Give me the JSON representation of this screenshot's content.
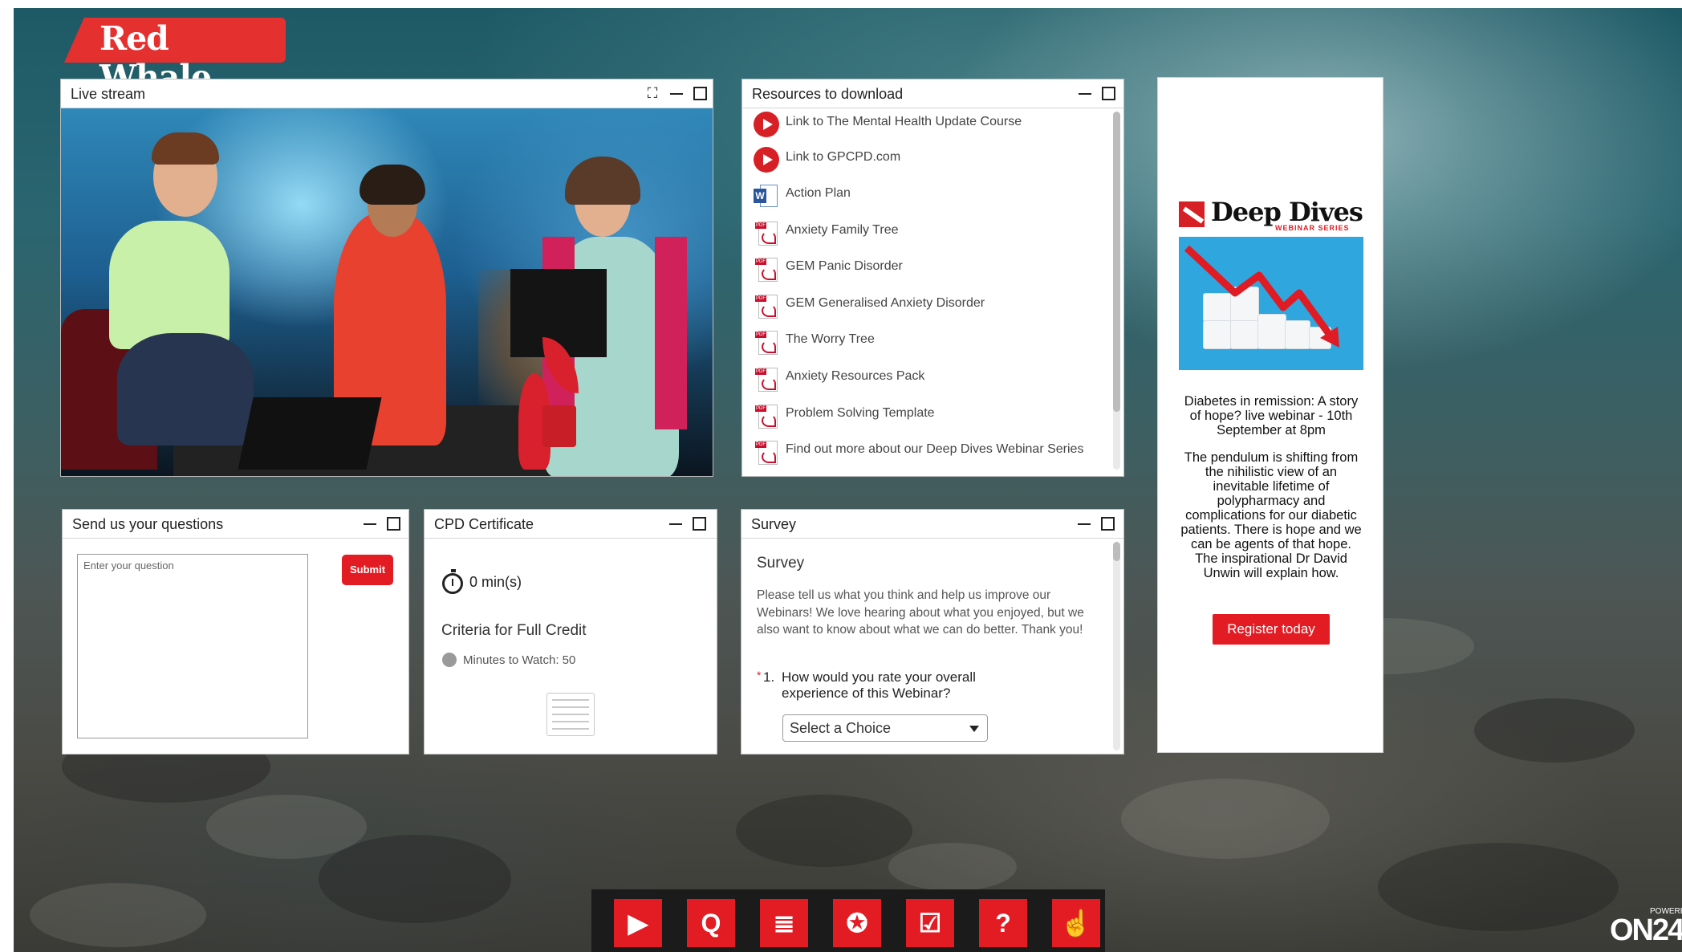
{
  "brand": {
    "name": "Red Whale",
    "powered_by": "POWERED BY",
    "on24": "ON24"
  },
  "live_stream": {
    "title": "Live stream"
  },
  "resources": {
    "title": "Resources to download",
    "items": [
      {
        "label": "Link to The Mental Health Update Course",
        "icon": "play-link-icon"
      },
      {
        "label": "Link to GPCPD.com",
        "icon": "play-link-icon"
      },
      {
        "label": "Action Plan",
        "icon": "word-doc-icon"
      },
      {
        "label": "Anxiety Family Tree",
        "icon": "pdf-icon"
      },
      {
        "label": "GEM Panic Disorder",
        "icon": "pdf-icon"
      },
      {
        "label": "GEM Generalised Anxiety Disorder",
        "icon": "pdf-icon"
      },
      {
        "label": "The Worry Tree",
        "icon": "pdf-icon"
      },
      {
        "label": "Anxiety Resources Pack",
        "icon": "pdf-icon"
      },
      {
        "label": "Problem Solving Template",
        "icon": "pdf-icon"
      },
      {
        "label": "Find out more about our Deep Dives Webinar Series",
        "icon": "pdf-icon"
      }
    ]
  },
  "ad": {
    "logo_text": "Deep Dives",
    "logo_sub": "WEBINAR SERIES",
    "headline": "Diabetes in remission: A story of hope? live webinar - 10th September at 8pm",
    "body": "The pendulum is shifting from the nihilistic view of an inevitable lifetime of polypharmacy and complications for our diabetic patients. There is hope and we can be agents of that hope. The inspirational Dr David Unwin will explain how.",
    "cta": "Register today"
  },
  "questions": {
    "title": "Send us your questions",
    "placeholder": "Enter your question",
    "submit": "Submit"
  },
  "cpd": {
    "title": "CPD Certificate",
    "time": "0 min(s)",
    "criteria_heading": "Criteria for Full Credit",
    "criteria_item": "Minutes to Watch: 50"
  },
  "survey": {
    "title": "Survey",
    "heading": "Survey",
    "intro": "Please tell us what you think and help us improve our Webinars!  We love hearing about what you enjoyed, but we also want to know about what we can do better. Thank you!",
    "required_mark": "*",
    "question_number": "1.",
    "question": "How would you rate your overall experience of this Webinar?",
    "select_value": "Select a Choice"
  },
  "toolbar": {
    "items": [
      {
        "name": "media-player",
        "glyph": "▶"
      },
      {
        "name": "questions",
        "glyph": "Q"
      },
      {
        "name": "resources",
        "glyph": "≣"
      },
      {
        "name": "certificate",
        "glyph": "✪"
      },
      {
        "name": "survey",
        "glyph": "☑"
      },
      {
        "name": "help",
        "glyph": "?"
      },
      {
        "name": "interaction",
        "glyph": "☝"
      }
    ]
  },
  "colors": {
    "accent": "#e31b23",
    "background": "#2a6570"
  }
}
